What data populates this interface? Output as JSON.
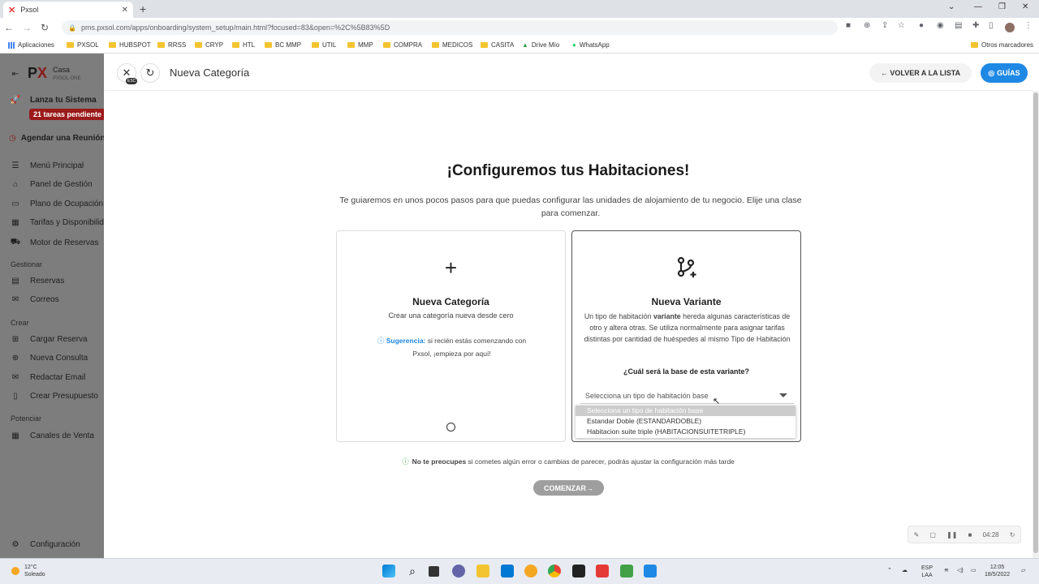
{
  "browser": {
    "tab_title": "Pxsol",
    "url": "pms.pxsol.com/apps/onboarding/system_setup/main.html?focused=83&open=%2C%5B83%5D",
    "bookmarks": [
      "Aplicaciones",
      "PXSOL",
      "HUBSPOT",
      "RRSS",
      "CRYP",
      "HTL",
      "BC MMP",
      "UTIL",
      "MMP",
      "COMPRA",
      "MEDICOS",
      "CASITA",
      "Drive Mío",
      "WhatsApp"
    ],
    "other_bookmarks": "Otros marcadores"
  },
  "sidebar": {
    "brand_name": "Casa",
    "brand_sub": "PXSOL ONE",
    "launch_label": "Lanza tu Sistema",
    "pending_badge": "21 tareas pendiente",
    "schedule_label": "Agendar una Reunión",
    "items_main": [
      "Menú Principal",
      "Panel de Gestión",
      "Plano de Ocupación",
      "Tarifas y Disponibilid",
      "Motor de Reservas"
    ],
    "section_gestionar": "Gestionar",
    "items_gestionar": [
      "Reservas",
      "Correos"
    ],
    "section_crear": "Crear",
    "items_crear": [
      "Cargar Reserva",
      "Nueva Consulta",
      "Redactar Email",
      "Crear Presupuesto"
    ],
    "section_potenciar": "Potenciar",
    "items_potenciar": [
      "Canales de Venta"
    ],
    "config_label": "Configuración"
  },
  "topbar": {
    "esc_label": "ESC",
    "page_title": "Nueva Categoría",
    "back_label": "← VOLVER A LA LISTA",
    "guides_label": "GUÍAS"
  },
  "content": {
    "heading": "¡Configuremos tus Habitaciones!",
    "intro": "Te guiaremos en unos pocos pasos para que puedas configurar las unidades de alojamiento de tu negocio. Elije una clase para comenzar.",
    "card_new": {
      "title": "Nueva Categoría",
      "subtitle": "Crear una categoría nueva desde cero",
      "tip_key": "Sugerencia:",
      "tip_text": " si recién estás comenzando con Pxsol, ¡empieza por aquí!"
    },
    "card_variant": {
      "title": "Nueva Variante",
      "desc_before": "Un tipo de habitación ",
      "desc_bold": "variante",
      "desc_after": " hereda algunas características de otro y altera otras. Se utiliza normalmente para asignar tarifas distintas por cantidad de huéspedes al mismo Tipo de Habitación",
      "question": "¿Cuál será la base de esta variante?",
      "select_placeholder": "Selecciona un tipo de habitación base",
      "options": [
        "Selecciona un tipo de habitación base",
        "Estandar Doble (ESTANDARDOBLE)",
        "Habitacion suite triple (HABITACIONSUITETRIPLE)"
      ]
    },
    "note_bold": "No te preocupes",
    "note_text": " si cometes algún error o cambias de parecer, podrás ajustar la configuración más tarde",
    "start_button": "COMENZAR→",
    "recorder_time": "04:28"
  },
  "taskbar": {
    "temp": "12°C",
    "weather": "Soleado",
    "lang1": "ESP",
    "lang2": "LAA",
    "time": "12:05",
    "date": "18/5/2022"
  },
  "colors": {
    "accent": "#1e88e5",
    "badge": "#9a1a1a",
    "sidebar_overlay": "#7d7d7d"
  }
}
